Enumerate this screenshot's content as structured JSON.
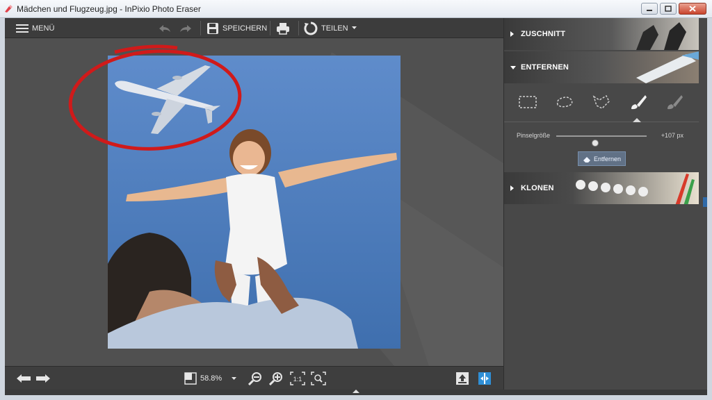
{
  "window": {
    "title": "Mädchen und Flugzeug.jpg - InPixio Photo Eraser"
  },
  "toolbar": {
    "menu_label": "MENÜ",
    "save_label": "SPEICHERN",
    "share_label": "TEILEN"
  },
  "panel": {
    "sections": [
      {
        "label": "ZUSCHNITT",
        "state": "collapsed"
      },
      {
        "label": "ENTFERNEN",
        "state": "expanded"
      },
      {
        "label": "KLONEN",
        "state": "collapsed"
      }
    ],
    "remove": {
      "tools": [
        "rectangle-select-icon",
        "lasso-select-icon",
        "polygon-lasso-icon",
        "brush-icon",
        "eraser-brush-icon"
      ],
      "active_tool": "brush-icon",
      "brush_size_label": "Pinselgröße",
      "brush_size_value": "+107 px",
      "brush_size_fraction": 0.43,
      "action_label": "Entfernen"
    }
  },
  "statusbar": {
    "zoom": "58.8%"
  },
  "colors": {
    "accent": "#2f6aa8",
    "annotation_circle": "#d01a1a",
    "sky": "#4f7fbe"
  }
}
